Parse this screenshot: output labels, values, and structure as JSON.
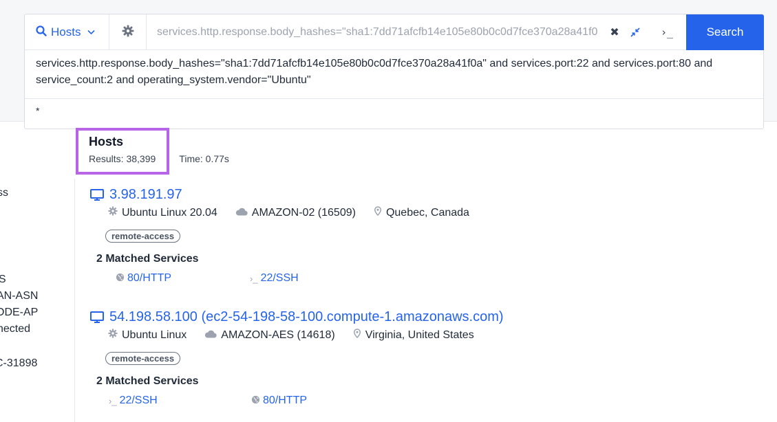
{
  "search": {
    "type_label": "Hosts",
    "query_value": "services.http.response.body_hashes=\"sha1:7dd71afcfb14e105e80b0c0d7fce370a28a41f0a\"",
    "clear_symbol": "✖",
    "cli_symbol": "›_",
    "search_button": "Search",
    "expanded_query": "services.http.response.body_hashes=\"sha1:7dd71afcfb14e105e80b0c0d7fce370a28a41f0a\" and services.port:22 and services.port:80 and service_count:2 and operating_system.vendor=\"Ubuntu\"",
    "secondary_query": "*"
  },
  "sidebar": {
    "fragments": [
      "ss",
      "S",
      "AN-ASN",
      "ODE-AP",
      "nected",
      "C-31898"
    ]
  },
  "results": {
    "title": "Hosts",
    "count_text": "Results: 38,399",
    "time_text": "Time: 0.77s"
  },
  "hosts": [
    {
      "ip": "3.98.191.97",
      "os": "Ubuntu Linux 20.04",
      "asn": "AMAZON-02 (16509)",
      "location": "Quebec, Canada",
      "tag": "remote-access",
      "matched": "2 Matched Services",
      "services": [
        "80/HTTP",
        "22/SSH"
      ]
    },
    {
      "ip": "54.198.58.100 (ec2-54-198-58-100.compute-1.amazonaws.com)",
      "os": "Ubuntu Linux",
      "asn": "AMAZON-AES (14618)",
      "location": "Virginia, United States",
      "tag": "remote-access",
      "matched": "2 Matched Services",
      "services": [
        "22/SSH",
        "80/HTTP"
      ]
    }
  ],
  "colors": {
    "accent": "#2563eb",
    "highlight": "#b565e6",
    "muted_icon": "#9ca3af"
  }
}
